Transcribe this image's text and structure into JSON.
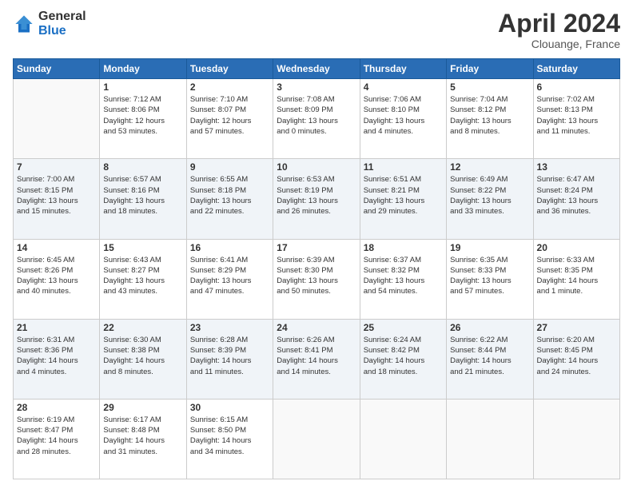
{
  "header": {
    "logo_line1": "General",
    "logo_line2": "Blue",
    "title": "April 2024",
    "location": "Clouange, France"
  },
  "days_of_week": [
    "Sunday",
    "Monday",
    "Tuesday",
    "Wednesday",
    "Thursday",
    "Friday",
    "Saturday"
  ],
  "weeks": [
    [
      {
        "num": "",
        "info": ""
      },
      {
        "num": "1",
        "info": "Sunrise: 7:12 AM\nSunset: 8:06 PM\nDaylight: 12 hours\nand 53 minutes."
      },
      {
        "num": "2",
        "info": "Sunrise: 7:10 AM\nSunset: 8:07 PM\nDaylight: 12 hours\nand 57 minutes."
      },
      {
        "num": "3",
        "info": "Sunrise: 7:08 AM\nSunset: 8:09 PM\nDaylight: 13 hours\nand 0 minutes."
      },
      {
        "num": "4",
        "info": "Sunrise: 7:06 AM\nSunset: 8:10 PM\nDaylight: 13 hours\nand 4 minutes."
      },
      {
        "num": "5",
        "info": "Sunrise: 7:04 AM\nSunset: 8:12 PM\nDaylight: 13 hours\nand 8 minutes."
      },
      {
        "num": "6",
        "info": "Sunrise: 7:02 AM\nSunset: 8:13 PM\nDaylight: 13 hours\nand 11 minutes."
      }
    ],
    [
      {
        "num": "7",
        "info": "Sunrise: 7:00 AM\nSunset: 8:15 PM\nDaylight: 13 hours\nand 15 minutes."
      },
      {
        "num": "8",
        "info": "Sunrise: 6:57 AM\nSunset: 8:16 PM\nDaylight: 13 hours\nand 18 minutes."
      },
      {
        "num": "9",
        "info": "Sunrise: 6:55 AM\nSunset: 8:18 PM\nDaylight: 13 hours\nand 22 minutes."
      },
      {
        "num": "10",
        "info": "Sunrise: 6:53 AM\nSunset: 8:19 PM\nDaylight: 13 hours\nand 26 minutes."
      },
      {
        "num": "11",
        "info": "Sunrise: 6:51 AM\nSunset: 8:21 PM\nDaylight: 13 hours\nand 29 minutes."
      },
      {
        "num": "12",
        "info": "Sunrise: 6:49 AM\nSunset: 8:22 PM\nDaylight: 13 hours\nand 33 minutes."
      },
      {
        "num": "13",
        "info": "Sunrise: 6:47 AM\nSunset: 8:24 PM\nDaylight: 13 hours\nand 36 minutes."
      }
    ],
    [
      {
        "num": "14",
        "info": "Sunrise: 6:45 AM\nSunset: 8:26 PM\nDaylight: 13 hours\nand 40 minutes."
      },
      {
        "num": "15",
        "info": "Sunrise: 6:43 AM\nSunset: 8:27 PM\nDaylight: 13 hours\nand 43 minutes."
      },
      {
        "num": "16",
        "info": "Sunrise: 6:41 AM\nSunset: 8:29 PM\nDaylight: 13 hours\nand 47 minutes."
      },
      {
        "num": "17",
        "info": "Sunrise: 6:39 AM\nSunset: 8:30 PM\nDaylight: 13 hours\nand 50 minutes."
      },
      {
        "num": "18",
        "info": "Sunrise: 6:37 AM\nSunset: 8:32 PM\nDaylight: 13 hours\nand 54 minutes."
      },
      {
        "num": "19",
        "info": "Sunrise: 6:35 AM\nSunset: 8:33 PM\nDaylight: 13 hours\nand 57 minutes."
      },
      {
        "num": "20",
        "info": "Sunrise: 6:33 AM\nSunset: 8:35 PM\nDaylight: 14 hours\nand 1 minute."
      }
    ],
    [
      {
        "num": "21",
        "info": "Sunrise: 6:31 AM\nSunset: 8:36 PM\nDaylight: 14 hours\nand 4 minutes."
      },
      {
        "num": "22",
        "info": "Sunrise: 6:30 AM\nSunset: 8:38 PM\nDaylight: 14 hours\nand 8 minutes."
      },
      {
        "num": "23",
        "info": "Sunrise: 6:28 AM\nSunset: 8:39 PM\nDaylight: 14 hours\nand 11 minutes."
      },
      {
        "num": "24",
        "info": "Sunrise: 6:26 AM\nSunset: 8:41 PM\nDaylight: 14 hours\nand 14 minutes."
      },
      {
        "num": "25",
        "info": "Sunrise: 6:24 AM\nSunset: 8:42 PM\nDaylight: 14 hours\nand 18 minutes."
      },
      {
        "num": "26",
        "info": "Sunrise: 6:22 AM\nSunset: 8:44 PM\nDaylight: 14 hours\nand 21 minutes."
      },
      {
        "num": "27",
        "info": "Sunrise: 6:20 AM\nSunset: 8:45 PM\nDaylight: 14 hours\nand 24 minutes."
      }
    ],
    [
      {
        "num": "28",
        "info": "Sunrise: 6:19 AM\nSunset: 8:47 PM\nDaylight: 14 hours\nand 28 minutes."
      },
      {
        "num": "29",
        "info": "Sunrise: 6:17 AM\nSunset: 8:48 PM\nDaylight: 14 hours\nand 31 minutes."
      },
      {
        "num": "30",
        "info": "Sunrise: 6:15 AM\nSunset: 8:50 PM\nDaylight: 14 hours\nand 34 minutes."
      },
      {
        "num": "",
        "info": ""
      },
      {
        "num": "",
        "info": ""
      },
      {
        "num": "",
        "info": ""
      },
      {
        "num": "",
        "info": ""
      }
    ]
  ]
}
